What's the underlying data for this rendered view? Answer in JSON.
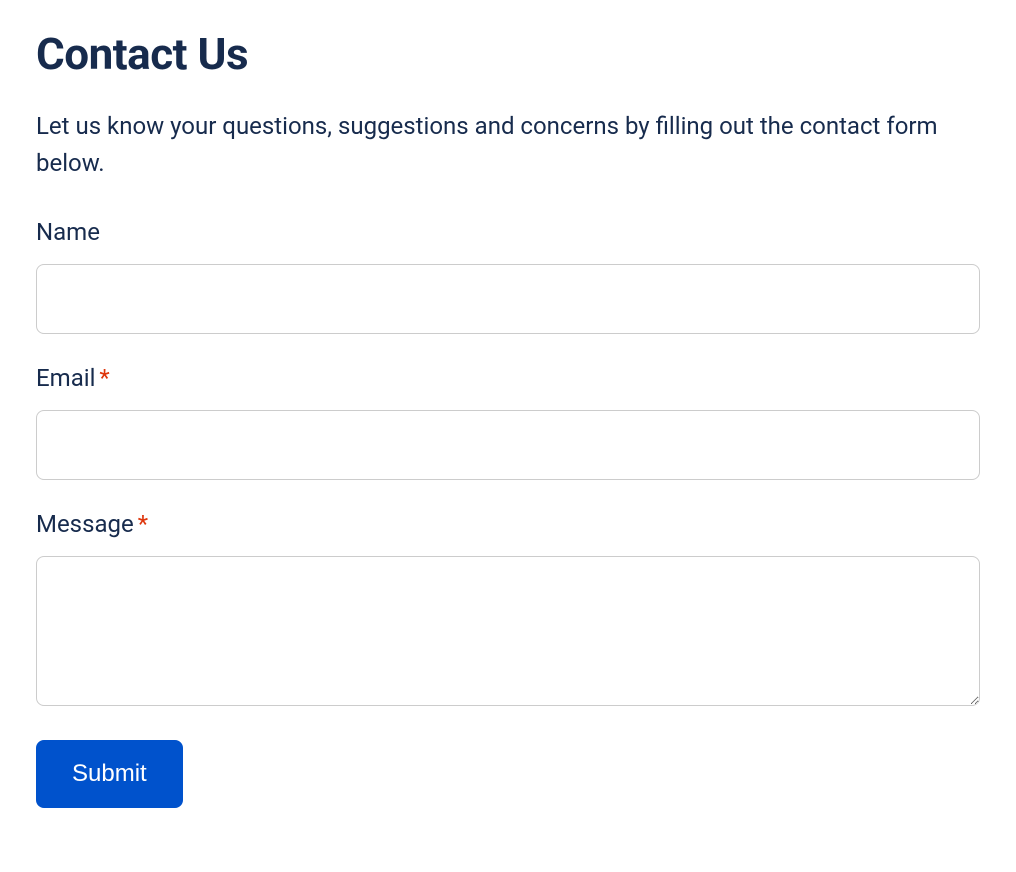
{
  "title": "Contact Us",
  "intro": "Let us know your questions, suggestions and concerns by filling out the contact form below.",
  "form": {
    "name": {
      "label": "Name",
      "required": false,
      "value": ""
    },
    "email": {
      "label": "Email",
      "required": true,
      "required_mark": "*",
      "value": ""
    },
    "message": {
      "label": "Message",
      "required": true,
      "required_mark": "*",
      "value": ""
    },
    "submit_label": "Submit"
  }
}
